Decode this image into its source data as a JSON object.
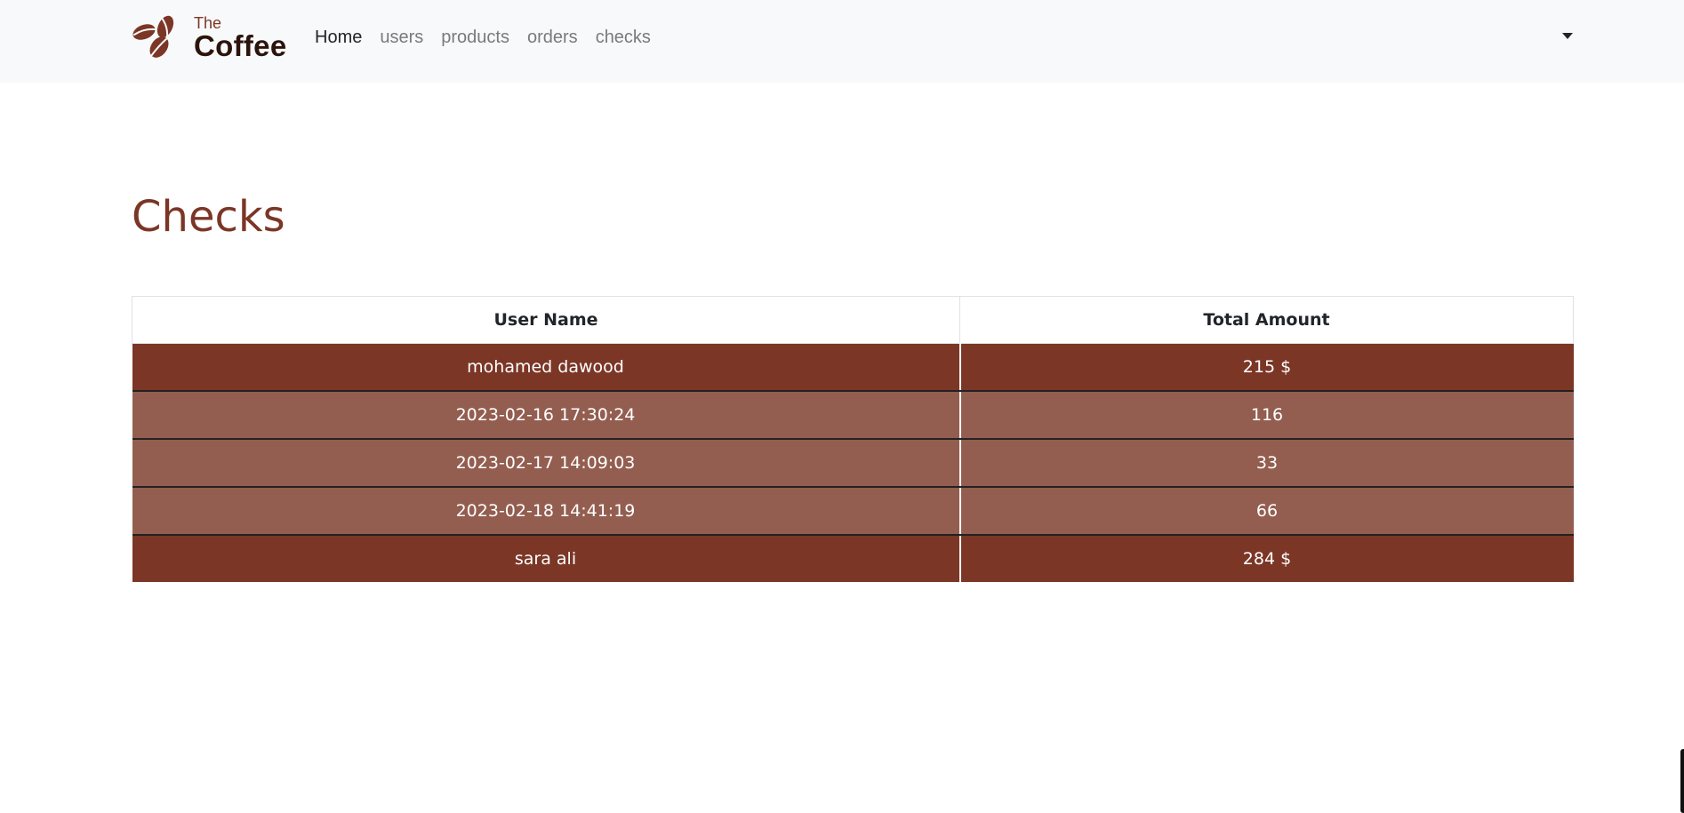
{
  "brand": {
    "the": "The",
    "name": "Coffee",
    "logo_icon": "coffee-beans-icon",
    "logo_color": "#7b3626"
  },
  "nav": {
    "links": [
      "Home",
      "users",
      "products",
      "orders",
      "checks"
    ],
    "active": "Home",
    "dropdown_icon": "caret-down-icon"
  },
  "page": {
    "title": "Checks"
  },
  "table": {
    "headers": [
      "User Name",
      "Total Amount"
    ],
    "rows": [
      {
        "type": "user",
        "name": "mohamed dawood",
        "amount": "215 $"
      },
      {
        "type": "check",
        "name": "2023-02-16 17:30:24",
        "amount": "116"
      },
      {
        "type": "check",
        "name": "2023-02-17 14:09:03",
        "amount": "33"
      },
      {
        "type": "check",
        "name": "2023-02-18 14:41:19",
        "amount": "66"
      },
      {
        "type": "user",
        "name": "sara ali",
        "amount": "284 $"
      }
    ]
  },
  "colors": {
    "accent": "#7b3626",
    "check_row": "#935e50",
    "navbar_bg": "#f8f9fa"
  }
}
